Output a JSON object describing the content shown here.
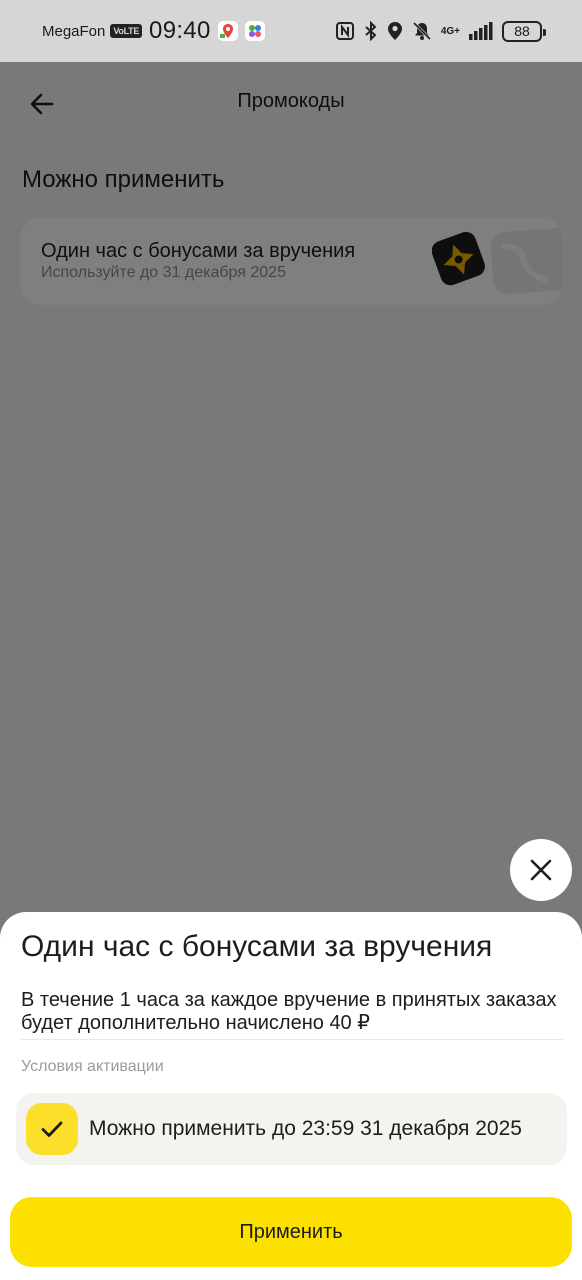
{
  "status_bar": {
    "carrier": "MegaFon",
    "volte": "VoLTE",
    "time": "09:40",
    "network": "4G+",
    "battery": "88"
  },
  "header": {
    "title": "Промокоды",
    "back_icon": "arrow-left-icon"
  },
  "section": {
    "title": "Можно применить"
  },
  "promo": {
    "title": "Один час с бонусами за вручения",
    "subtitle": "Используйте до 31 декабря 2025"
  },
  "sheet": {
    "close_icon": "close-icon",
    "title": "Один час с бонусами за вручения",
    "description": "В течение 1 часа за каждое вручение в принятых заказах будет дополнительно начислено 40 ₽",
    "conditions_label": "Условия активации",
    "condition_text": "Можно применить до 23:59 31 декабря 2025",
    "apply_label": "Применить"
  },
  "colors": {
    "accent": "#fce000",
    "sheet_bg": "#ffffff",
    "page_bg": "#f4f3f0",
    "text": "#1d1d1d",
    "muted": "#8d8d8d"
  }
}
